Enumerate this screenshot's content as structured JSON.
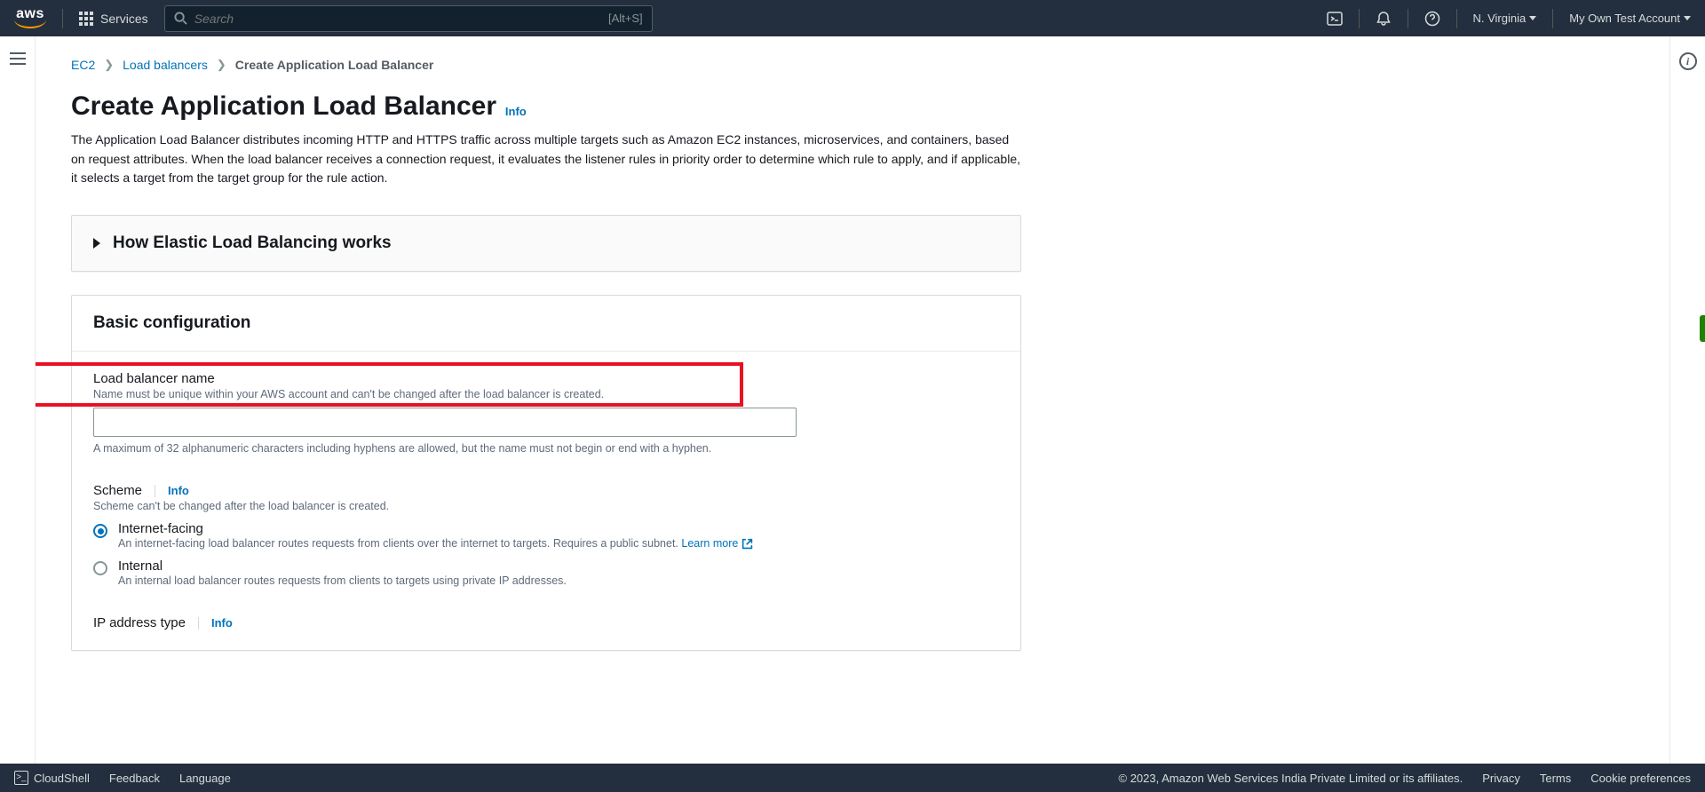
{
  "topnav": {
    "services": "Services",
    "search_placeholder": "Search",
    "search_shortcut": "[Alt+S]",
    "region": "N. Virginia",
    "account": "My Own Test Account"
  },
  "breadcrumbs": {
    "ec2": "EC2",
    "lb": "Load balancers",
    "current": "Create Application Load Balancer"
  },
  "page": {
    "title": "Create Application Load Balancer",
    "info": "Info",
    "description": "The Application Load Balancer distributes incoming HTTP and HTTPS traffic across multiple targets such as Amazon EC2 instances, microservices, and containers, based on request attributes. When the load balancer receives a connection request, it evaluates the listener rules in priority order to determine which rule to apply, and if applicable, it selects a target from the target group for the rule action."
  },
  "how_works": {
    "title": "How Elastic Load Balancing works"
  },
  "basic_config": {
    "title": "Basic configuration",
    "name": {
      "label": "Load balancer name",
      "desc": "Name must be unique within your AWS account and can't be changed after the load balancer is created.",
      "value": "",
      "hint": "A maximum of 32 alphanumeric characters including hyphens are allowed, but the name must not begin or end with a hyphen."
    },
    "scheme": {
      "label": "Scheme",
      "info": "Info",
      "desc": "Scheme can't be changed after the load balancer is created.",
      "options": [
        {
          "label": "Internet-facing",
          "desc": "An internet-facing load balancer routes requests from clients over the internet to targets. Requires a public subnet.",
          "learn_more": "Learn more",
          "selected": true
        },
        {
          "label": "Internal",
          "desc": "An internal load balancer routes requests from clients to targets using private IP addresses.",
          "selected": false
        }
      ]
    },
    "ip_type": {
      "label": "IP address type",
      "info": "Info"
    }
  },
  "footer": {
    "cloudshell": "CloudShell",
    "feedback": "Feedback",
    "language": "Language",
    "copyright": "© 2023, Amazon Web Services India Private Limited or its affiliates.",
    "privacy": "Privacy",
    "terms": "Terms",
    "cookies": "Cookie preferences"
  }
}
